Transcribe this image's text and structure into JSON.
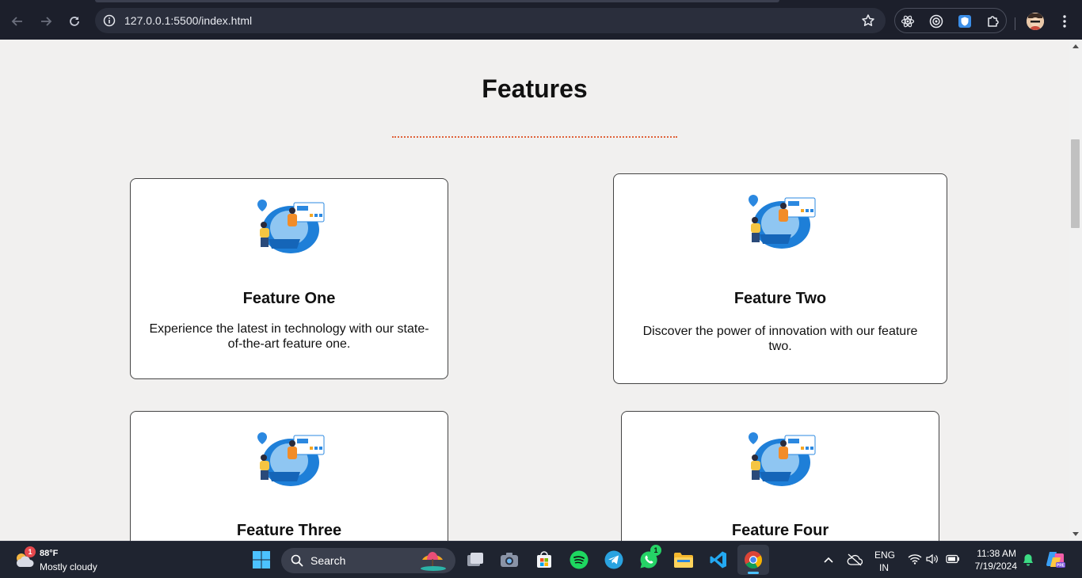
{
  "browser": {
    "url": "127.0.0.1:5500/index.html"
  },
  "page": {
    "title": "Features",
    "features": [
      {
        "title": "Feature One",
        "description": "Experience the latest in technology with our state-of-the-art feature one."
      },
      {
        "title": "Feature Two",
        "description": "Discover the power of innovation with our feature two."
      },
      {
        "title": "Feature Three",
        "description": ""
      },
      {
        "title": "Feature Four",
        "description": ""
      }
    ]
  },
  "taskbar": {
    "weather": {
      "temp": "88°F",
      "condition": "Mostly cloudy",
      "badge": "1"
    },
    "search_label": "Search",
    "whatsapp_badge": "1",
    "language": {
      "line1": "ENG",
      "line2": "IN"
    },
    "clock": {
      "time": "11:38 AM",
      "date": "7/19/2024"
    }
  },
  "colors": {
    "accent_rule": "#e0623a",
    "chrome_bg": "#1c1f2b",
    "page_bg": "#f1f0ef"
  }
}
